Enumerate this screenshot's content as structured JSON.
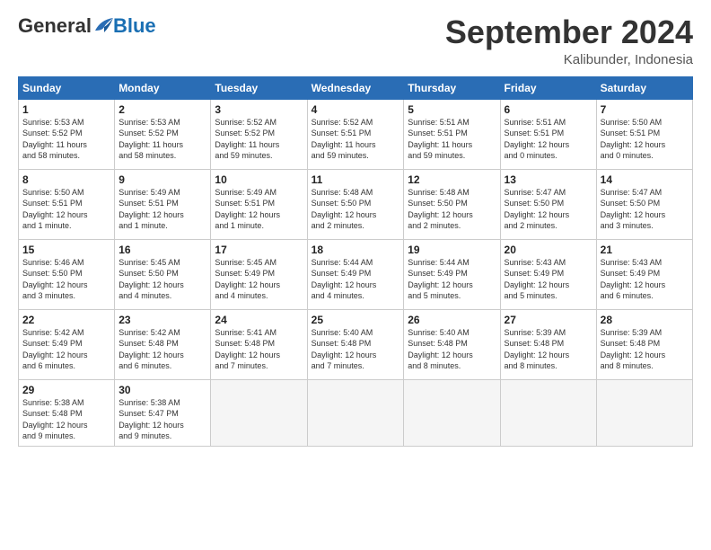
{
  "logo": {
    "general": "General",
    "blue": "Blue"
  },
  "title": "September 2024",
  "location": "Kalibunder, Indonesia",
  "days_of_week": [
    "Sunday",
    "Monday",
    "Tuesday",
    "Wednesday",
    "Thursday",
    "Friday",
    "Saturday"
  ],
  "weeks": [
    [
      {
        "day": "1",
        "info": "Sunrise: 5:53 AM\nSunset: 5:52 PM\nDaylight: 11 hours\nand 58 minutes."
      },
      {
        "day": "2",
        "info": "Sunrise: 5:53 AM\nSunset: 5:52 PM\nDaylight: 11 hours\nand 58 minutes."
      },
      {
        "day": "3",
        "info": "Sunrise: 5:52 AM\nSunset: 5:52 PM\nDaylight: 11 hours\nand 59 minutes."
      },
      {
        "day": "4",
        "info": "Sunrise: 5:52 AM\nSunset: 5:51 PM\nDaylight: 11 hours\nand 59 minutes."
      },
      {
        "day": "5",
        "info": "Sunrise: 5:51 AM\nSunset: 5:51 PM\nDaylight: 11 hours\nand 59 minutes."
      },
      {
        "day": "6",
        "info": "Sunrise: 5:51 AM\nSunset: 5:51 PM\nDaylight: 12 hours\nand 0 minutes."
      },
      {
        "day": "7",
        "info": "Sunrise: 5:50 AM\nSunset: 5:51 PM\nDaylight: 12 hours\nand 0 minutes."
      }
    ],
    [
      {
        "day": "8",
        "info": "Sunrise: 5:50 AM\nSunset: 5:51 PM\nDaylight: 12 hours\nand 1 minute."
      },
      {
        "day": "9",
        "info": "Sunrise: 5:49 AM\nSunset: 5:51 PM\nDaylight: 12 hours\nand 1 minute."
      },
      {
        "day": "10",
        "info": "Sunrise: 5:49 AM\nSunset: 5:51 PM\nDaylight: 12 hours\nand 1 minute."
      },
      {
        "day": "11",
        "info": "Sunrise: 5:48 AM\nSunset: 5:50 PM\nDaylight: 12 hours\nand 2 minutes."
      },
      {
        "day": "12",
        "info": "Sunrise: 5:48 AM\nSunset: 5:50 PM\nDaylight: 12 hours\nand 2 minutes."
      },
      {
        "day": "13",
        "info": "Sunrise: 5:47 AM\nSunset: 5:50 PM\nDaylight: 12 hours\nand 2 minutes."
      },
      {
        "day": "14",
        "info": "Sunrise: 5:47 AM\nSunset: 5:50 PM\nDaylight: 12 hours\nand 3 minutes."
      }
    ],
    [
      {
        "day": "15",
        "info": "Sunrise: 5:46 AM\nSunset: 5:50 PM\nDaylight: 12 hours\nand 3 minutes."
      },
      {
        "day": "16",
        "info": "Sunrise: 5:45 AM\nSunset: 5:50 PM\nDaylight: 12 hours\nand 4 minutes."
      },
      {
        "day": "17",
        "info": "Sunrise: 5:45 AM\nSunset: 5:49 PM\nDaylight: 12 hours\nand 4 minutes."
      },
      {
        "day": "18",
        "info": "Sunrise: 5:44 AM\nSunset: 5:49 PM\nDaylight: 12 hours\nand 4 minutes."
      },
      {
        "day": "19",
        "info": "Sunrise: 5:44 AM\nSunset: 5:49 PM\nDaylight: 12 hours\nand 5 minutes."
      },
      {
        "day": "20",
        "info": "Sunrise: 5:43 AM\nSunset: 5:49 PM\nDaylight: 12 hours\nand 5 minutes."
      },
      {
        "day": "21",
        "info": "Sunrise: 5:43 AM\nSunset: 5:49 PM\nDaylight: 12 hours\nand 6 minutes."
      }
    ],
    [
      {
        "day": "22",
        "info": "Sunrise: 5:42 AM\nSunset: 5:49 PM\nDaylight: 12 hours\nand 6 minutes."
      },
      {
        "day": "23",
        "info": "Sunrise: 5:42 AM\nSunset: 5:48 PM\nDaylight: 12 hours\nand 6 minutes."
      },
      {
        "day": "24",
        "info": "Sunrise: 5:41 AM\nSunset: 5:48 PM\nDaylight: 12 hours\nand 7 minutes."
      },
      {
        "day": "25",
        "info": "Sunrise: 5:40 AM\nSunset: 5:48 PM\nDaylight: 12 hours\nand 7 minutes."
      },
      {
        "day": "26",
        "info": "Sunrise: 5:40 AM\nSunset: 5:48 PM\nDaylight: 12 hours\nand 8 minutes."
      },
      {
        "day": "27",
        "info": "Sunrise: 5:39 AM\nSunset: 5:48 PM\nDaylight: 12 hours\nand 8 minutes."
      },
      {
        "day": "28",
        "info": "Sunrise: 5:39 AM\nSunset: 5:48 PM\nDaylight: 12 hours\nand 8 minutes."
      }
    ],
    [
      {
        "day": "29",
        "info": "Sunrise: 5:38 AM\nSunset: 5:48 PM\nDaylight: 12 hours\nand 9 minutes."
      },
      {
        "day": "30",
        "info": "Sunrise: 5:38 AM\nSunset: 5:47 PM\nDaylight: 12 hours\nand 9 minutes."
      },
      {
        "day": "",
        "info": ""
      },
      {
        "day": "",
        "info": ""
      },
      {
        "day": "",
        "info": ""
      },
      {
        "day": "",
        "info": ""
      },
      {
        "day": "",
        "info": ""
      }
    ]
  ]
}
